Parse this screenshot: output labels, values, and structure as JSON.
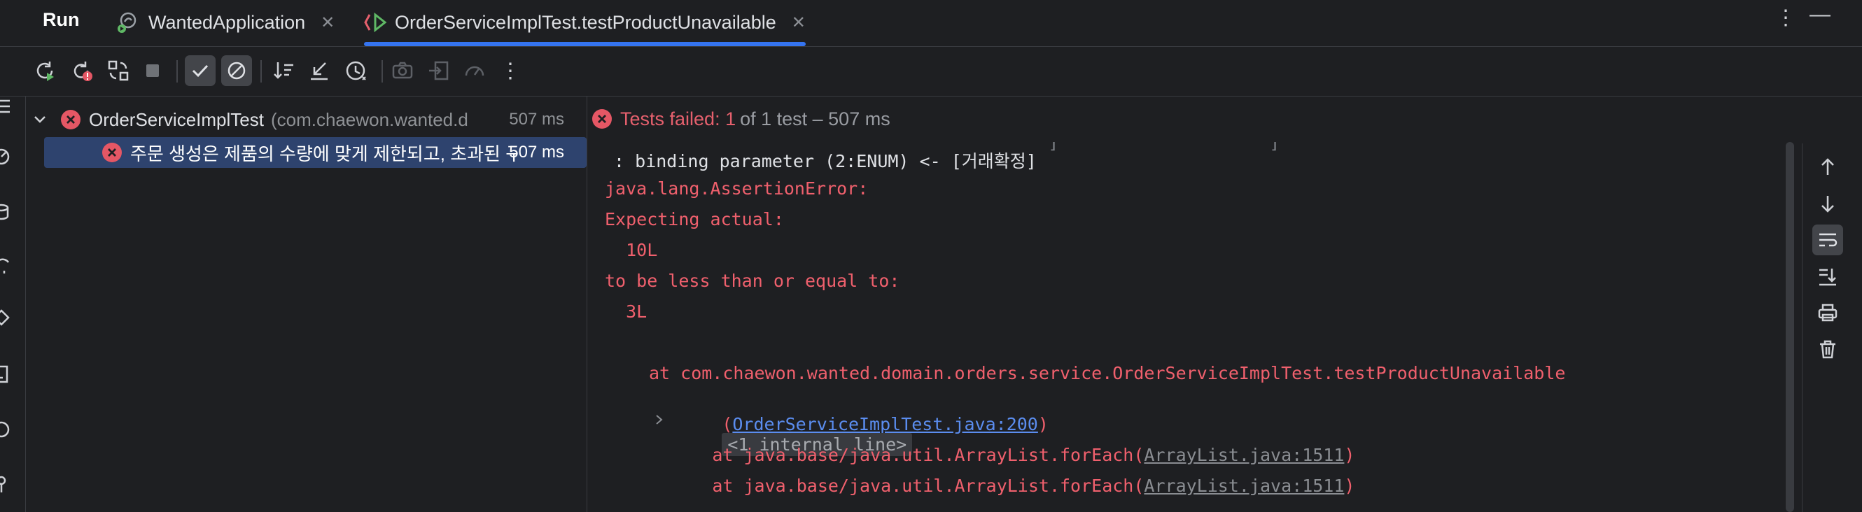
{
  "tabbar": {
    "run_label": "Run",
    "tabs": [
      {
        "label": "WantedApplication",
        "icon": "spring-boot-app-icon",
        "active": false
      },
      {
        "label": "OrderServiceImplTest.testProductUnavailable",
        "icon": "test-class-icon",
        "active": true
      }
    ],
    "more_icon": "more-vertical-icon",
    "minimize_icon": "minimize-icon"
  },
  "toolbar": {
    "buttons": [
      {
        "name": "rerun",
        "icon": "rerun-icon"
      },
      {
        "name": "rerun-failed",
        "icon": "rerun-failed-tests-icon"
      },
      {
        "name": "toggle-auto-test",
        "icon": "toggle-auto-test-icon"
      },
      {
        "name": "stop",
        "icon": "stop-icon"
      },
      {
        "name": "show-passed",
        "icon": "check-icon",
        "toggled": true
      },
      {
        "name": "show-ignored",
        "icon": "ignored-icon",
        "toggled": true
      },
      {
        "name": "sort",
        "icon": "sort-icon"
      },
      {
        "name": "collapse",
        "icon": "collapse-icon"
      },
      {
        "name": "history",
        "icon": "history-icon"
      },
      {
        "name": "screenshot",
        "icon": "camera-icon"
      },
      {
        "name": "import",
        "icon": "import-icon"
      },
      {
        "name": "coverage",
        "icon": "gauge-icon"
      },
      {
        "name": "more",
        "icon": "more-vertical-icon"
      }
    ]
  },
  "tree": {
    "root": {
      "label": "OrderServiceImplTest",
      "package": "(com.chaewon.wanted.d",
      "duration": "507 ms",
      "status": "failed"
    },
    "child": {
      "label": "주문 생성은 제품의 수량에 맞게 제한되고, 초과된 구",
      "duration": "507 ms",
      "status": "failed"
    }
  },
  "status": {
    "failed_text": "Tests failed: 1",
    "rest_text": "of 1 test – 507 ms"
  },
  "console": {
    "line_binding": " : binding parameter (2:ENUM) <- [거래확정]",
    "line_error": "java.lang.AssertionError:",
    "line_expecting": "Expecting actual:",
    "line_actual": "  10L",
    "line_tobe": "to be less than or equal to:",
    "line_expected": "  3L",
    "line_at1": "at com.chaewon.wanted.domain.orders.service.OrderServiceImplTest.testProductUnavailable",
    "line_at1_paren_open": "(",
    "line_at1_link": "OrderServiceImplTest.java:200",
    "line_at1_paren_close": ")",
    "line_at1_fold": "<1 internal line>",
    "line_at2_prefix": "at java.base/java.util.ArrayList.forEach(",
    "line_at2_link": "ArrayList.java:1511",
    "line_at2_suffix": ")",
    "line_at3_prefix": "at java.base/java.util.ArrayList.forEach(",
    "line_at3_link": "ArrayList.java:1511",
    "line_at3_suffix": ")"
  },
  "right_tools": [
    {
      "name": "up",
      "icon": "arrow-up-icon"
    },
    {
      "name": "down",
      "icon": "arrow-down-icon"
    },
    {
      "name": "soft-wrap",
      "icon": "soft-wrap-icon",
      "toggled": true
    },
    {
      "name": "scroll-to-end",
      "icon": "scroll-to-end-icon"
    },
    {
      "name": "print",
      "icon": "print-icon"
    },
    {
      "name": "clear",
      "icon": "trash-icon"
    }
  ],
  "colors": {
    "background": "#1e1f22",
    "error_red": "#f0606d",
    "selection": "#2e436e",
    "accent": "#3574f0",
    "link": "#5b8def"
  }
}
